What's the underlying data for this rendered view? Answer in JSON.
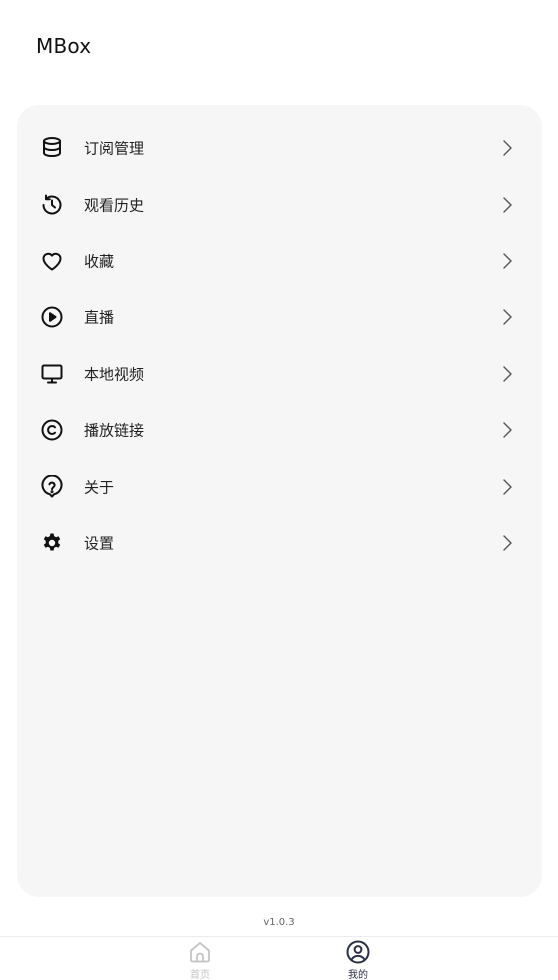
{
  "app": {
    "title": "MBox",
    "version": "v1.0.3"
  },
  "menu": {
    "items": [
      {
        "label": "订阅管理",
        "icon": "database-icon"
      },
      {
        "label": "观看历史",
        "icon": "history-icon"
      },
      {
        "label": "收藏",
        "icon": "heart-icon"
      },
      {
        "label": "直播",
        "icon": "play-circle-icon"
      },
      {
        "label": "本地视频",
        "icon": "monitor-icon"
      },
      {
        "label": "播放链接",
        "icon": "copyright-icon"
      },
      {
        "label": "关于",
        "icon": "question-icon"
      },
      {
        "label": "设置",
        "icon": "gear-icon"
      }
    ]
  },
  "nav": {
    "tabs": [
      {
        "label": "首页",
        "icon": "home-icon",
        "active": false
      },
      {
        "label": "我的",
        "icon": "user-circle-icon",
        "active": true
      }
    ]
  },
  "colors": {
    "card_background": "#f6f6f6",
    "active_tab": "#2a2f45",
    "inactive_tab": "#c4c4c4"
  }
}
